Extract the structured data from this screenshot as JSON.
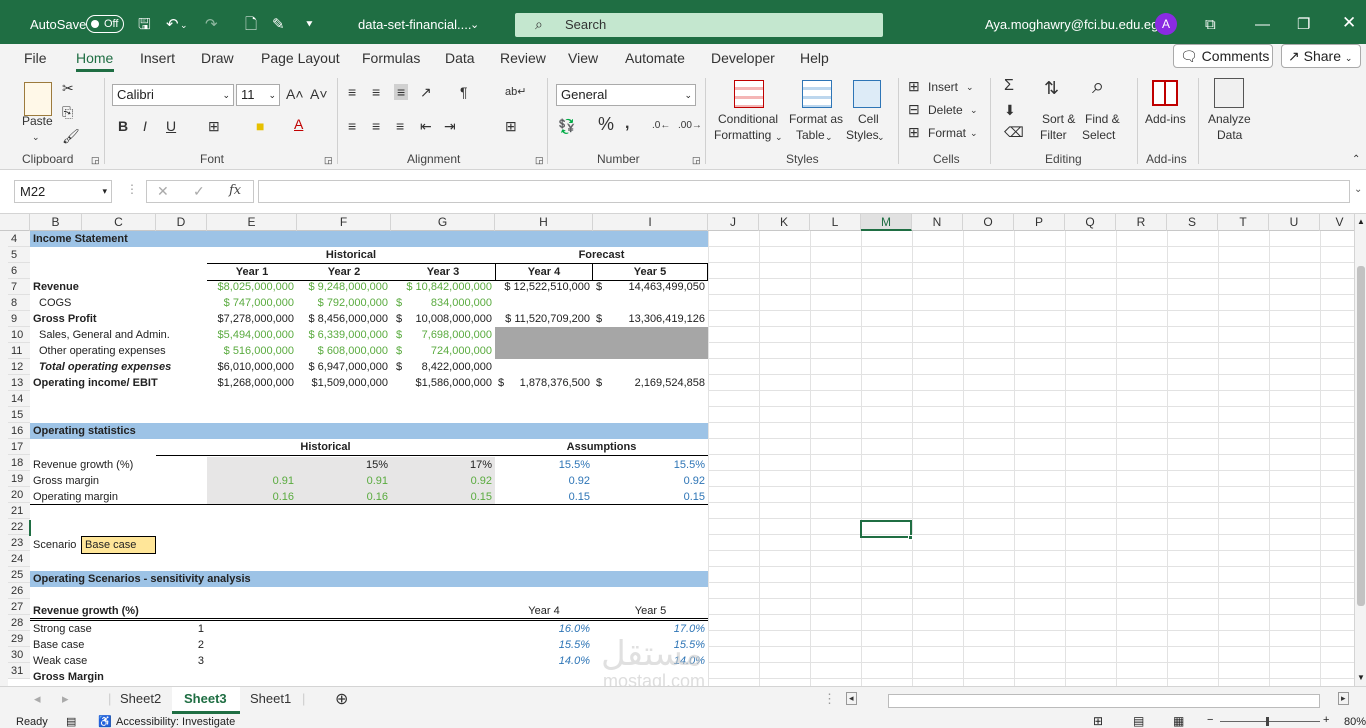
{
  "title_bar": {
    "autosave_label": "AutoSave",
    "autosave_state": "Off",
    "file_name": "data-set-financial....",
    "search_placeholder": "Search",
    "user_email": "Aya.moghawry@fci.bu.edu.eg",
    "avatar_initial": "A"
  },
  "menu": {
    "tabs": [
      "File",
      "Home",
      "Insert",
      "Draw",
      "Page Layout",
      "Formulas",
      "Data",
      "Review",
      "View",
      "Automate",
      "Developer",
      "Help"
    ],
    "active_tab": "Home",
    "comments_label": "Comments",
    "share_label": "Share"
  },
  "ribbon": {
    "clipboard": {
      "paste_label": "Paste",
      "group_label": "Clipboard"
    },
    "font": {
      "font_name": "Calibri",
      "font_size": "11",
      "group_label": "Font"
    },
    "alignment": {
      "group_label": "Alignment"
    },
    "number": {
      "format": "General",
      "group_label": "Number"
    },
    "styles": {
      "conditional_line1": "Conditional",
      "conditional_line2": "Formatting",
      "format_table_line1": "Format as",
      "format_table_line2": "Table",
      "cell_styles_line1": "Cell",
      "cell_styles_line2": "Styles",
      "group_label": "Styles"
    },
    "cells": {
      "insert_label": "Insert",
      "delete_label": "Delete",
      "format_label": "Format",
      "group_label": "Cells"
    },
    "editing": {
      "sort_line1": "Sort &",
      "sort_line2": "Filter",
      "find_line1": "Find &",
      "find_line2": "Select",
      "group_label": "Editing"
    },
    "addins": {
      "addins_label": "Add-ins",
      "group_label": "Add-ins"
    },
    "analyze": {
      "line1": "Analyze",
      "line2": "Data"
    }
  },
  "formula_bar": {
    "name_box": "M22",
    "fx_label": "fx",
    "formula": ""
  },
  "columns": [
    "B",
    "C",
    "D",
    "E",
    "F",
    "G",
    "H",
    "I",
    "J",
    "K",
    "L",
    "M",
    "N",
    "O",
    "P",
    "Q",
    "R",
    "S",
    "T",
    "U",
    "V"
  ],
  "selected_column": "M",
  "rows": [
    "4",
    "5",
    "6",
    "7",
    "8",
    "9",
    "10",
    "11",
    "12",
    "13",
    "14",
    "15",
    "16",
    "17",
    "18",
    "19",
    "20",
    "21",
    "22",
    "23",
    "24",
    "25",
    "26",
    "27",
    "28",
    "29",
    "30",
    "31"
  ],
  "sheet": {
    "income_statement_title": "Income Statement",
    "historical_label": "Historical",
    "forecast_label": "Forecast",
    "year_headers": [
      "Year 1",
      "Year 2",
      "Year 3",
      "Year 4",
      "Year 5"
    ],
    "revenue": {
      "label": "Revenue",
      "values": [
        "$8,025,000,000",
        "$ 9,248,000,000",
        "$ 10,842,000,000",
        "$ 12,522,510,000",
        "$",
        "14,463,499,050"
      ]
    },
    "cogs": {
      "label": "COGS",
      "values": [
        "$ 747,000,000",
        "$ 792,000,000",
        "$",
        "834,000,000"
      ]
    },
    "gross_profit": {
      "label": "Gross Profit",
      "values": [
        "$7,278,000,000",
        "$ 8,456,000,000",
        "$",
        "10,008,000,000",
        "$ 11,520,709,200",
        "$",
        "13,306,419,126"
      ]
    },
    "sga": {
      "label": "Sales, General and Admin.",
      "values": [
        "$5,494,000,000",
        "$ 6,339,000,000",
        "$",
        "7,698,000,000"
      ]
    },
    "other_opex": {
      "label": "Other operating expenses",
      "values": [
        "$ 516,000,000",
        "$ 608,000,000",
        "$",
        "724,000,000"
      ]
    },
    "total_opex": {
      "label": "Total operating expenses",
      "values": [
        "$6,010,000,000",
        "$ 6,947,000,000",
        "$",
        "8,422,000,000"
      ]
    },
    "ebit": {
      "label": "Operating income/ EBIT",
      "values": [
        "$1,268,000,000",
        "$1,509,000,000",
        "$1,586,000,000",
        "$",
        "1,878,376,500",
        "$",
        "2,169,524,858"
      ]
    },
    "op_stats_title": "Operating statistics",
    "assumptions_label": "Assumptions",
    "rev_growth": {
      "label": "Revenue growth (%)",
      "values": [
        "15%",
        "17%",
        "15.5%",
        "15.5%"
      ]
    },
    "gross_margin": {
      "label": "Gross margin",
      "values": [
        "0.91",
        "0.91",
        "0.92",
        "0.92",
        "0.92"
      ]
    },
    "op_margin": {
      "label": "Operating margin",
      "values": [
        "0.16",
        "0.16",
        "0.15",
        "0.15",
        "0.15"
      ]
    },
    "scenario_label": "Scenario",
    "scenario_value": "Base case",
    "sensitivity_title": "Operating Scenarios - sensitivity analysis",
    "rev_growth_pct": "Revenue growth (%)",
    "year4": "Year 4",
    "year5": "Year 5",
    "strong": {
      "label": "Strong case",
      "num": "1",
      "y4": "16.0%",
      "y5": "17.0%"
    },
    "base": {
      "label": "Base case",
      "num": "2",
      "y4": "15.5%",
      "y5": "15.5%"
    },
    "weak": {
      "label": "Weak case",
      "num": "3",
      "y4": "14.0%",
      "y5": "14.0%"
    },
    "gross_margin_title": "Gross Margin"
  },
  "sheet_tabs": [
    "Sheet2",
    "Sheet3",
    "Sheet1"
  ],
  "active_sheet": "Sheet3",
  "status": {
    "ready": "Ready",
    "accessibility": "Accessibility: Investigate",
    "zoom": "80%"
  },
  "watermark": {
    "arabic": "مستقل",
    "latin": "mostaql.com"
  }
}
